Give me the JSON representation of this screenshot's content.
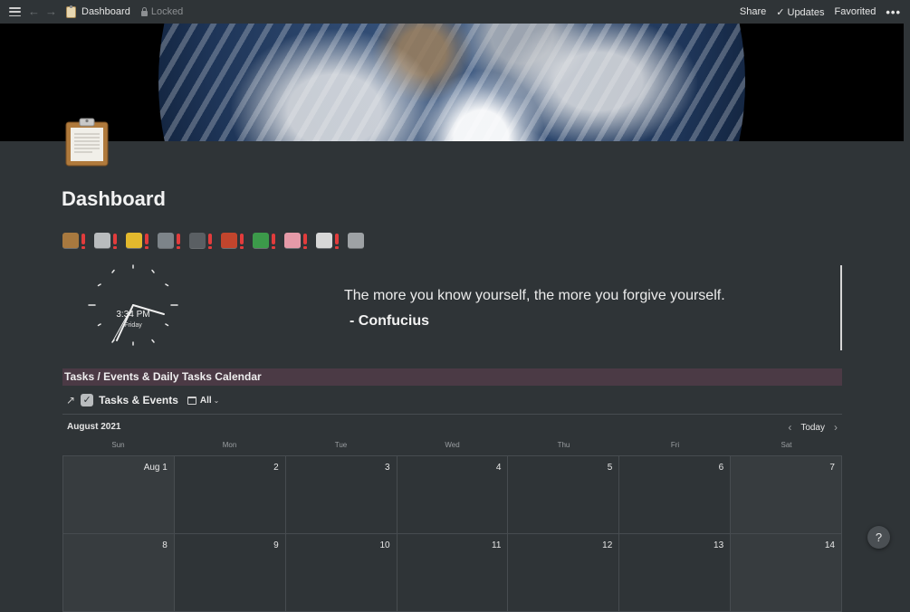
{
  "topbar": {
    "breadcrumb": "Dashboard",
    "lock_label": "Locked",
    "share": "Share",
    "updates": "Updates",
    "favorited": "Favorited",
    "more": "•••"
  },
  "page": {
    "title": "Dashboard",
    "icon": "clipboard-icon",
    "cover": "earth-from-space",
    "icon_row": [
      "package-icon",
      "checkbox-icon",
      "notebook-icon",
      "coffee-machine-icon",
      "phone-book-icon",
      "pencil-icon",
      "recycle-icon",
      "brain-icon",
      "open-book-icon",
      "notepad-icon"
    ]
  },
  "clock": {
    "time": "3:34 PM",
    "day": "Friday"
  },
  "quote": {
    "text": "The more you know yourself, the more you forgive yourself.",
    "author": "- Confucius"
  },
  "section": {
    "title": "Tasks / Events & Daily Tasks Calendar"
  },
  "database": {
    "title": "Tasks & Events",
    "view": "All"
  },
  "calendar": {
    "month": "August 2021",
    "today": "Today",
    "weekdays": [
      "Sun",
      "Mon",
      "Tue",
      "Wed",
      "Thu",
      "Fri",
      "Sat"
    ],
    "days": [
      "Aug 1",
      "2",
      "3",
      "4",
      "5",
      "6",
      "7",
      "8",
      "9",
      "10",
      "11",
      "12",
      "13",
      "14"
    ]
  },
  "help": "?",
  "colors": {
    "background": "#2f3437",
    "section_bar": "#4b3a45",
    "alert": "#e23c3c"
  }
}
